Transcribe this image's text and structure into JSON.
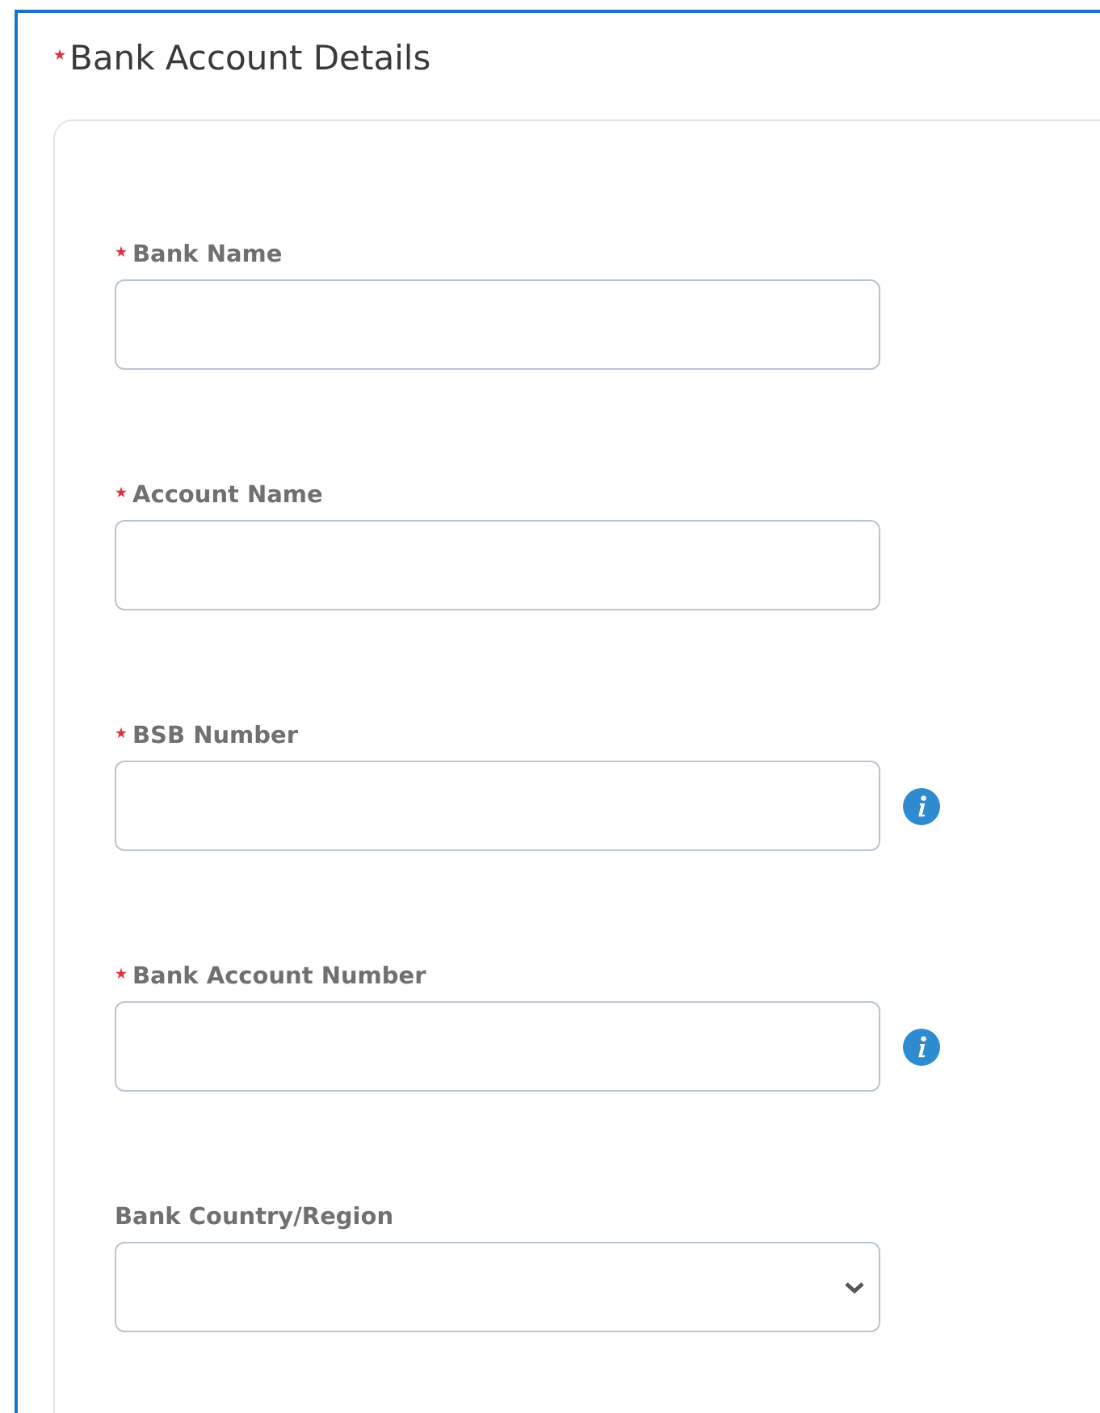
{
  "section": {
    "title": "Bank Account Details",
    "required": true
  },
  "fields": [
    {
      "kind": "text",
      "label": "Bank Name",
      "required": true,
      "info": false
    },
    {
      "kind": "text",
      "label": "Account Name",
      "required": true,
      "info": false
    },
    {
      "kind": "text",
      "label": "BSB Number",
      "required": true,
      "info": true
    },
    {
      "kind": "text",
      "label": "Bank Account Number",
      "required": true,
      "info": true
    },
    {
      "kind": "select",
      "label": "Bank Country/Region",
      "required": false,
      "info": false
    }
  ]
}
